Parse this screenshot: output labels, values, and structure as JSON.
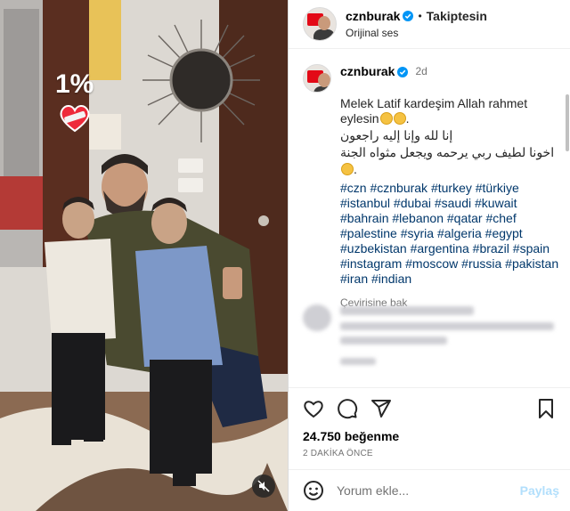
{
  "media": {
    "overlay_text": "1%",
    "heart_icon": "heart-bandage-icon",
    "mute_icon": "speaker-muted-icon"
  },
  "header": {
    "username": "cznburak",
    "follow_status": "Takiptesin",
    "audio": "Orijinal ses",
    "separator": "•"
  },
  "caption": {
    "username": "cznburak",
    "time": "2d",
    "text_line1": "Melek Latif kardeşim Allah rahmet eylesin",
    "arabic1": "إنا لله وإنا إليه راجعون",
    "arabic2": "اخونا لطيف ربي يرحمه ويجعل مثواه الجنة",
    "hashtags": "#czn #cznburak #turkey #türkiye #istanbul #dubai #saudi #kuwait #bahrain #lebanon #qatar #chef #palestine #syria #algeria #egypt #uzbekistan #argentina #brazil #spain #instagram #moscow #russia #pakistan #iran #indian",
    "translate": "Çevirisine bak"
  },
  "actions": {
    "like_icon": "heart-outline-icon",
    "comment_icon": "comment-icon",
    "share_icon": "share-icon",
    "save_icon": "bookmark-icon",
    "likes": "24.750 beğenme",
    "timestamp": "2 DAKİKA ÖNCE"
  },
  "add_comment": {
    "emoji_icon": "smiley-icon",
    "placeholder": "Yorum ekle...",
    "post_label": "Paylaş"
  },
  "colors": {
    "verified": "#0095f6",
    "hashtag": "#00376b",
    "post_disabled": "#b2dffc"
  }
}
